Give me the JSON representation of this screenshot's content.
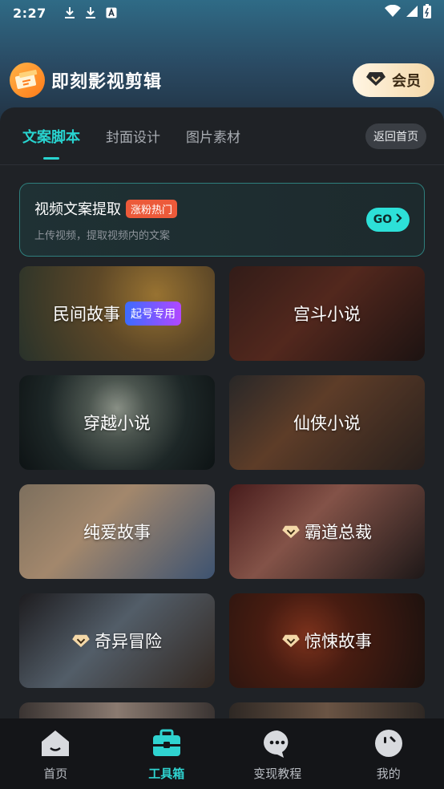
{
  "status_bar": {
    "time": "2:27"
  },
  "header": {
    "app_title": "即刻影视剪辑",
    "vip_label": "会员"
  },
  "tabs": [
    {
      "label": "文案脚本",
      "active": true
    },
    {
      "label": "封面设计",
      "active": false
    },
    {
      "label": "图片素材",
      "active": false
    }
  ],
  "back_home_label": "返回首页",
  "extract": {
    "title": "视频文案提取",
    "badge": "涨粉热门",
    "subtitle": "上传视频，提取视频内的文案",
    "go_label": "GO"
  },
  "cards": [
    {
      "label": "民间故事",
      "tag": "起号专用",
      "premium": false
    },
    {
      "label": "宫斗小说",
      "tag": "",
      "premium": false
    },
    {
      "label": "穿越小说",
      "tag": "",
      "premium": false
    },
    {
      "label": "仙侠小说",
      "tag": "",
      "premium": false
    },
    {
      "label": "纯爱故事",
      "tag": "",
      "premium": false
    },
    {
      "label": "霸道总裁",
      "tag": "",
      "premium": true
    },
    {
      "label": "奇异冒险",
      "tag": "",
      "premium": true
    },
    {
      "label": "惊悚故事",
      "tag": "",
      "premium": true
    }
  ],
  "bottom_nav": [
    {
      "label": "首页",
      "icon": "home-icon",
      "active": false
    },
    {
      "label": "工具箱",
      "icon": "toolbox-icon",
      "active": true
    },
    {
      "label": "变现教程",
      "icon": "chat-icon",
      "active": false
    },
    {
      "label": "我的",
      "icon": "profile-icon",
      "active": false
    }
  ],
  "colors": {
    "accent": "#28d3cf",
    "hot": "#ec5a3a",
    "vip": "#f4d8a8"
  }
}
